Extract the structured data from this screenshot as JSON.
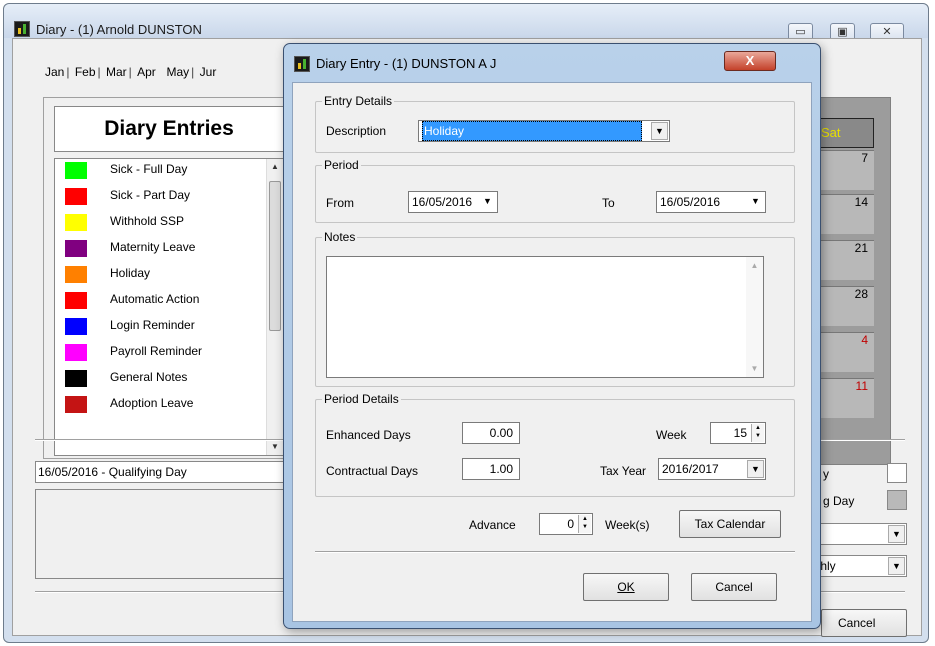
{
  "main_window": {
    "title": "Diary - (1) Arnold DUNSTON",
    "caption_buttons": [
      "▭",
      "▣",
      "✕"
    ],
    "month_tabs": [
      "Jan",
      "Feb",
      "Mar",
      "Apr",
      "May",
      "Jur"
    ],
    "diary_header": "Diary Entries",
    "legend": [
      {
        "label": "Sick - Full Day",
        "color": "#00ff00"
      },
      {
        "label": "Sick - Part Day",
        "color": "#ff0000"
      },
      {
        "label": "Withhold SSP",
        "color": "#ffff00"
      },
      {
        "label": "Maternity Leave",
        "color": "#800080"
      },
      {
        "label": "Holiday",
        "color": "#ff8000"
      },
      {
        "label": "Automatic Action",
        "color": "#ff0000"
      },
      {
        "label": "Login Reminder",
        "color": "#0000ff"
      },
      {
        "label": "Payroll Reminder",
        "color": "#ff00ff"
      },
      {
        "label": "General Notes",
        "color": "#000000"
      },
      {
        "label": "Adoption Leave",
        "color": "#c41414"
      }
    ],
    "calendar": {
      "header": "Sat",
      "days": [
        "7",
        "14",
        "21",
        "28",
        "4",
        "11"
      ]
    },
    "status_text": "16/05/2016 - Qualifying Day",
    "right_labels": {
      "label1": "y",
      "label2": "g Day"
    },
    "right_combo2": "thly",
    "cancel_label": "Cancel"
  },
  "dialog": {
    "title": "Diary Entry - (1) DUNSTON A J",
    "close_glyph": "X",
    "entry_details": {
      "caption": "Entry Details",
      "description_label": "Description",
      "description_value": "Holiday"
    },
    "period": {
      "caption": "Period",
      "from_label": "From",
      "from_value": "16/05/2016",
      "to_label": "To",
      "to_value": "16/05/2016"
    },
    "notes": {
      "caption": "Notes"
    },
    "period_details": {
      "caption": "Period Details",
      "enhanced_label": "Enhanced Days",
      "enhanced_value": "0.00",
      "week_label": "Week",
      "week_value": "15",
      "contractual_label": "Contractual Days",
      "contractual_value": "1.00",
      "tax_year_label": "Tax Year",
      "tax_year_value": "2016/2017"
    },
    "advance": {
      "label": "Advance",
      "value": "0",
      "suffix": "Week(s)",
      "tax_calendar_label": "Tax Calendar"
    },
    "ok_label": "OK",
    "cancel_label": "Cancel"
  }
}
